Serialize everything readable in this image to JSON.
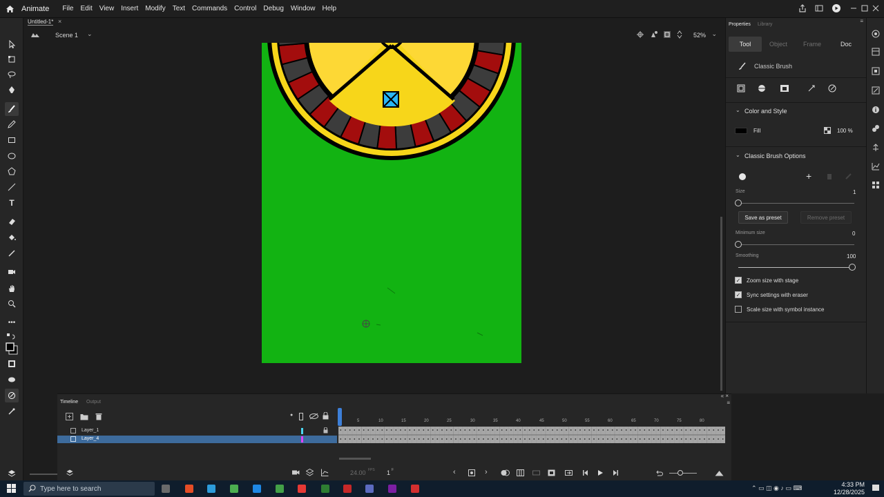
{
  "menubar": {
    "app_name": "Animate",
    "items": [
      "File",
      "Edit",
      "View",
      "Insert",
      "Modify",
      "Text",
      "Commands",
      "Control",
      "Debug",
      "Window",
      "Help"
    ]
  },
  "document": {
    "tab_title": "Untitled-1*",
    "scene_label": "Scene 1",
    "zoom": "52%"
  },
  "properties": {
    "panel_tabs": [
      "Properties",
      "Library"
    ],
    "subtabs": [
      "Tool",
      "Object",
      "Frame",
      "Doc"
    ],
    "active_subtab": "Tool",
    "tool_name": "Classic Brush",
    "color_and_style": {
      "header": "Color and Style",
      "fill_label": "Fill",
      "fill_color": "#000000",
      "opacity": "100 %"
    },
    "brush_options": {
      "header": "Classic Brush Options",
      "size_label": "Size",
      "size_value": "1",
      "save_preset": "Save as preset",
      "remove_preset": "Remove preset",
      "min_size_label": "Minimum size",
      "min_size_value": "0",
      "smoothing_label": "Smoothing",
      "smoothing_value": "100",
      "checkboxes": [
        {
          "label": "Zoom size with stage",
          "checked": true
        },
        {
          "label": "Sync settings with eraser",
          "checked": true
        },
        {
          "label": "Scale size with symbol instance",
          "checked": false
        }
      ]
    }
  },
  "timeline": {
    "tabs": [
      "Timeline",
      "Output"
    ],
    "layers": [
      {
        "name": "Layer_1",
        "color": "#4ad7f0",
        "selected": false
      },
      {
        "name": "Layer_4",
        "color": "#e040fb",
        "selected": true
      }
    ],
    "frame_numbers": [
      "5",
      "10",
      "15",
      "20",
      "25",
      "30",
      "35",
      "40",
      "45",
      "50",
      "55",
      "60",
      "65",
      "70",
      "75",
      "80"
    ],
    "fps": "24.00",
    "fps_unit": "FPS",
    "current_frame": "1",
    "frame_unit": "F"
  },
  "stage": {
    "background_color": "#12b312",
    "wheel_colors": {
      "gold": "#f7d61a",
      "yellow": "#fdd835",
      "red": "#a30d0d",
      "gray": "#3c3c3c",
      "black": "#000000",
      "cyan": "#29b6f6"
    }
  },
  "taskbar": {
    "search_placeholder": "Type here to search",
    "time": "4:33 PM",
    "date": "12/28/2025"
  },
  "colors": {
    "accent": "#3d7fd8",
    "selected_layer": "#3d6b9c"
  }
}
